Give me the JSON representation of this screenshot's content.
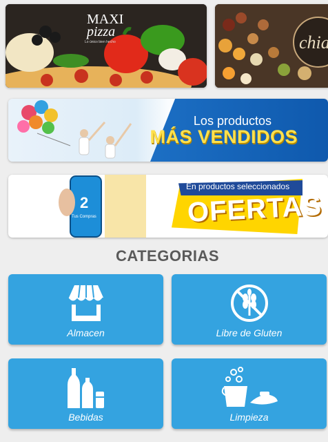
{
  "banners": {
    "pizza": {
      "brand_top": "MAXI",
      "brand_bottom": "pizza",
      "tagline": "Lo único bien hecho"
    },
    "nuts": {
      "brand": "chia"
    },
    "mas_vendidos": {
      "line1": "Los productos",
      "line2": "MÁS VENDIDOS"
    },
    "ofertas": {
      "line1": "En productos seleccionados",
      "line2": "OFERTAS",
      "phone_text": "Tus Compras"
    }
  },
  "categories": {
    "title": "CATEGORIAS",
    "items": [
      {
        "label": "Almacen",
        "icon": "store-icon"
      },
      {
        "label": "Libre de Gluten",
        "icon": "gluten-free-icon"
      },
      {
        "label": "Bebidas",
        "icon": "bottles-icon"
      },
      {
        "label": "Limpieza",
        "icon": "cleaning-icon"
      }
    ]
  },
  "colors": {
    "tile_blue": "#34a3e0",
    "banner_blue": "#1c6fc4",
    "offer_yellow": "#ffd500"
  }
}
